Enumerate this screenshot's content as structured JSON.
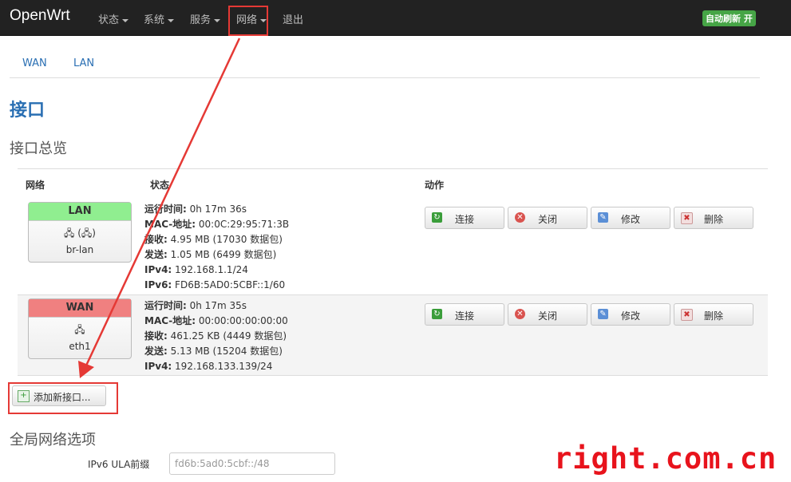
{
  "nav": {
    "brand": "OpenWrt",
    "items": [
      "状态",
      "系统",
      "服务",
      "网络",
      "退出"
    ],
    "auto_refresh": "自动刷新 开"
  },
  "tabs": [
    "WAN",
    "LAN"
  ],
  "page_title": "接口",
  "section_title": "接口总览",
  "table": {
    "headers": [
      "网络",
      "状态",
      "动作"
    ],
    "rows": [
      {
        "name": "LAN",
        "icons": "🖧 (🖧)",
        "device": "br-lan",
        "status": [
          {
            "k": "运行时间:",
            "v": " 0h 17m 36s"
          },
          {
            "k": "MAC-地址:",
            "v": " 00:0C:29:95:71:3B"
          },
          {
            "k": "接收:",
            "v": " 4.95 MB (17030 数据包)"
          },
          {
            "k": "发送:",
            "v": " 1.05 MB (6499 数据包)"
          },
          {
            "k": "IPv4:",
            "v": " 192.168.1.1/24"
          },
          {
            "k": "IPv6:",
            "v": " FD6B:5AD0:5CBF::1/60"
          }
        ]
      },
      {
        "name": "WAN",
        "icons": "🖧",
        "device": "eth1",
        "status": [
          {
            "k": "运行时间:",
            "v": " 0h 17m 35s"
          },
          {
            "k": "MAC-地址:",
            "v": " 00:00:00:00:00:00"
          },
          {
            "k": "接收:",
            "v": " 461.25 KB (4449 数据包)"
          },
          {
            "k": "发送:",
            "v": " 5.13 MB (15204 数据包)"
          },
          {
            "k": "IPv4:",
            "v": " 192.168.133.139/24"
          }
        ]
      }
    ],
    "actions": [
      "连接",
      "关闭",
      "修改",
      "删除"
    ]
  },
  "add_button": "添加新接口...",
  "global_title": "全局网络选项",
  "ula": {
    "label": "IPv6 ULA前缀",
    "value": "fd6b:5ad0:5cbf::/48"
  },
  "watermark": "right.com.cn",
  "colors": {
    "topbar": "#222222",
    "link": "#2a6fb3",
    "lan": "#90ee90",
    "wan": "#f08080",
    "annotation": "#e53935",
    "watermark": "#e8131c"
  }
}
